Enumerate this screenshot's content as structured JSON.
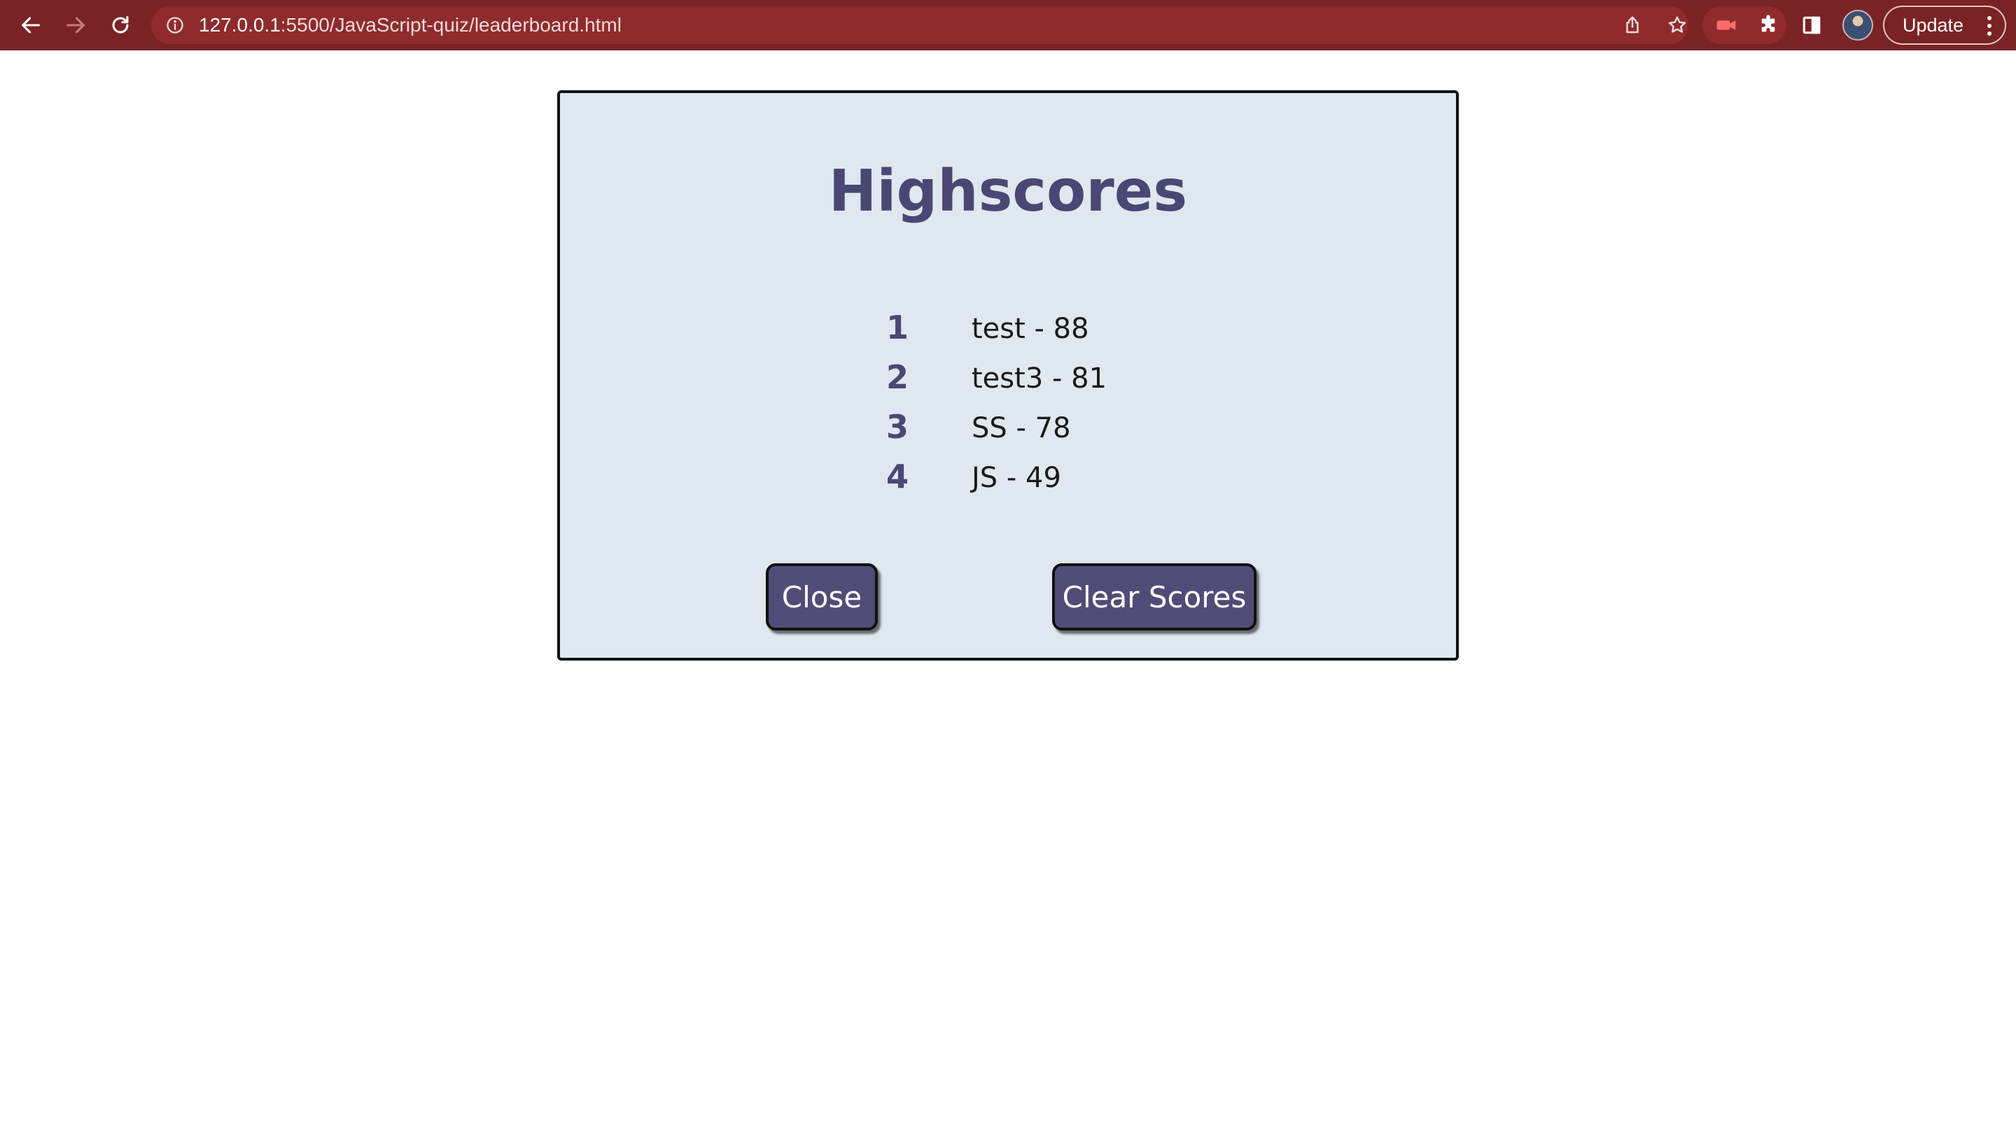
{
  "browser": {
    "url_host": "127.0.0.1",
    "url_rest": ":5500/JavaScript-quiz/leaderboard.html",
    "update_label": "Update",
    "icons": [
      "back-icon",
      "forward-icon",
      "reload-icon",
      "info-icon",
      "share-icon",
      "star-icon",
      "extension-icon",
      "puzzle-icon",
      "sidebar-icon",
      "avatar",
      "more-icon"
    ],
    "toolbar_color": "#7a2325"
  },
  "leaderboard": {
    "title": "Highscores",
    "scores": [
      {
        "rank": "1",
        "entry": "test - 88"
      },
      {
        "rank": "2",
        "entry": "test3 - 81"
      },
      {
        "rank": "3",
        "entry": "SS - 78"
      },
      {
        "rank": "4",
        "entry": "JS - 49"
      }
    ],
    "close_label": "Close",
    "clear_label": "Clear Scores"
  },
  "colors": {
    "panel_bg": "#dfe8ef",
    "accent": "#4a4775",
    "button_bg": "#514c77"
  }
}
